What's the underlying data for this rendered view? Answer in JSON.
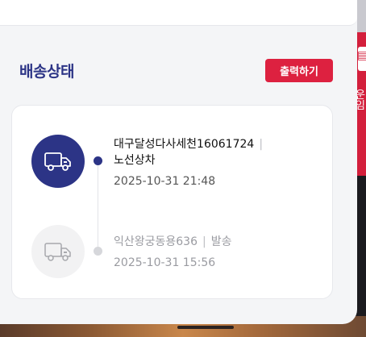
{
  "section_title": "배송상태",
  "print_button_label": "출력하기",
  "background": {
    "side_text": "운임"
  },
  "steps": [
    {
      "location": "대구달성다사세천16061724",
      "status": "노선상차",
      "datetime": "2025-10-31 21:48",
      "active": true,
      "icon": "truck-icon"
    },
    {
      "location": "익산왕궁동용636",
      "status": "발송",
      "datetime": "2025-10-31 15:56",
      "active": false,
      "icon": "truck-icon"
    }
  ],
  "colors": {
    "accent": "#2c3486",
    "button": "#dd2140",
    "inactive": "#9a9ba1"
  }
}
